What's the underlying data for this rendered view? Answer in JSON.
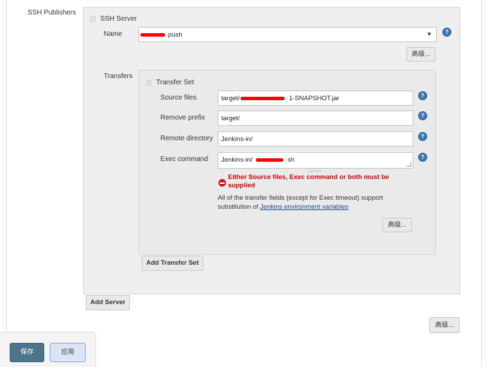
{
  "section": {
    "title": "SSH Publishers"
  },
  "server": {
    "title": "SSH Server",
    "name_label": "Name",
    "name_value": "push",
    "advanced_label": "高级..."
  },
  "transfers": {
    "label": "Transfers",
    "set_title": "Transfer Set",
    "source_files_label": "Source files",
    "source_files_prefix": "target/",
    "source_files_value": "1-SNAPSHOT.jar",
    "remove_prefix_label": "Remove prefix",
    "remove_prefix_value": "target/",
    "remote_directory_label": "Remote directory",
    "remote_directory_value": "Jenkins-in/",
    "exec_command_label": "Exec command",
    "exec_command_prefix": "Jenkins-in/",
    "exec_command_suffix": "sh",
    "error_text": "Either Source files, Exec command or both must be supplied",
    "info_text": "All of the transfer fields (except for Exec timeout) support substitution of",
    "info_link": "Jenkins environment variables",
    "advanced_label": "高级...",
    "add_transfer_label": "Add Transfer Set"
  },
  "add_server_label": "Add Server",
  "outer_advanced_label": "高级...",
  "footer": {
    "save_label": "保存",
    "apply_label": "应用"
  },
  "colors": {
    "help": "#3b76b6",
    "error": "#cc0000",
    "save_bg": "#4b758b",
    "apply_bg": "#dbe5f6",
    "redaction": "#ff0000"
  }
}
